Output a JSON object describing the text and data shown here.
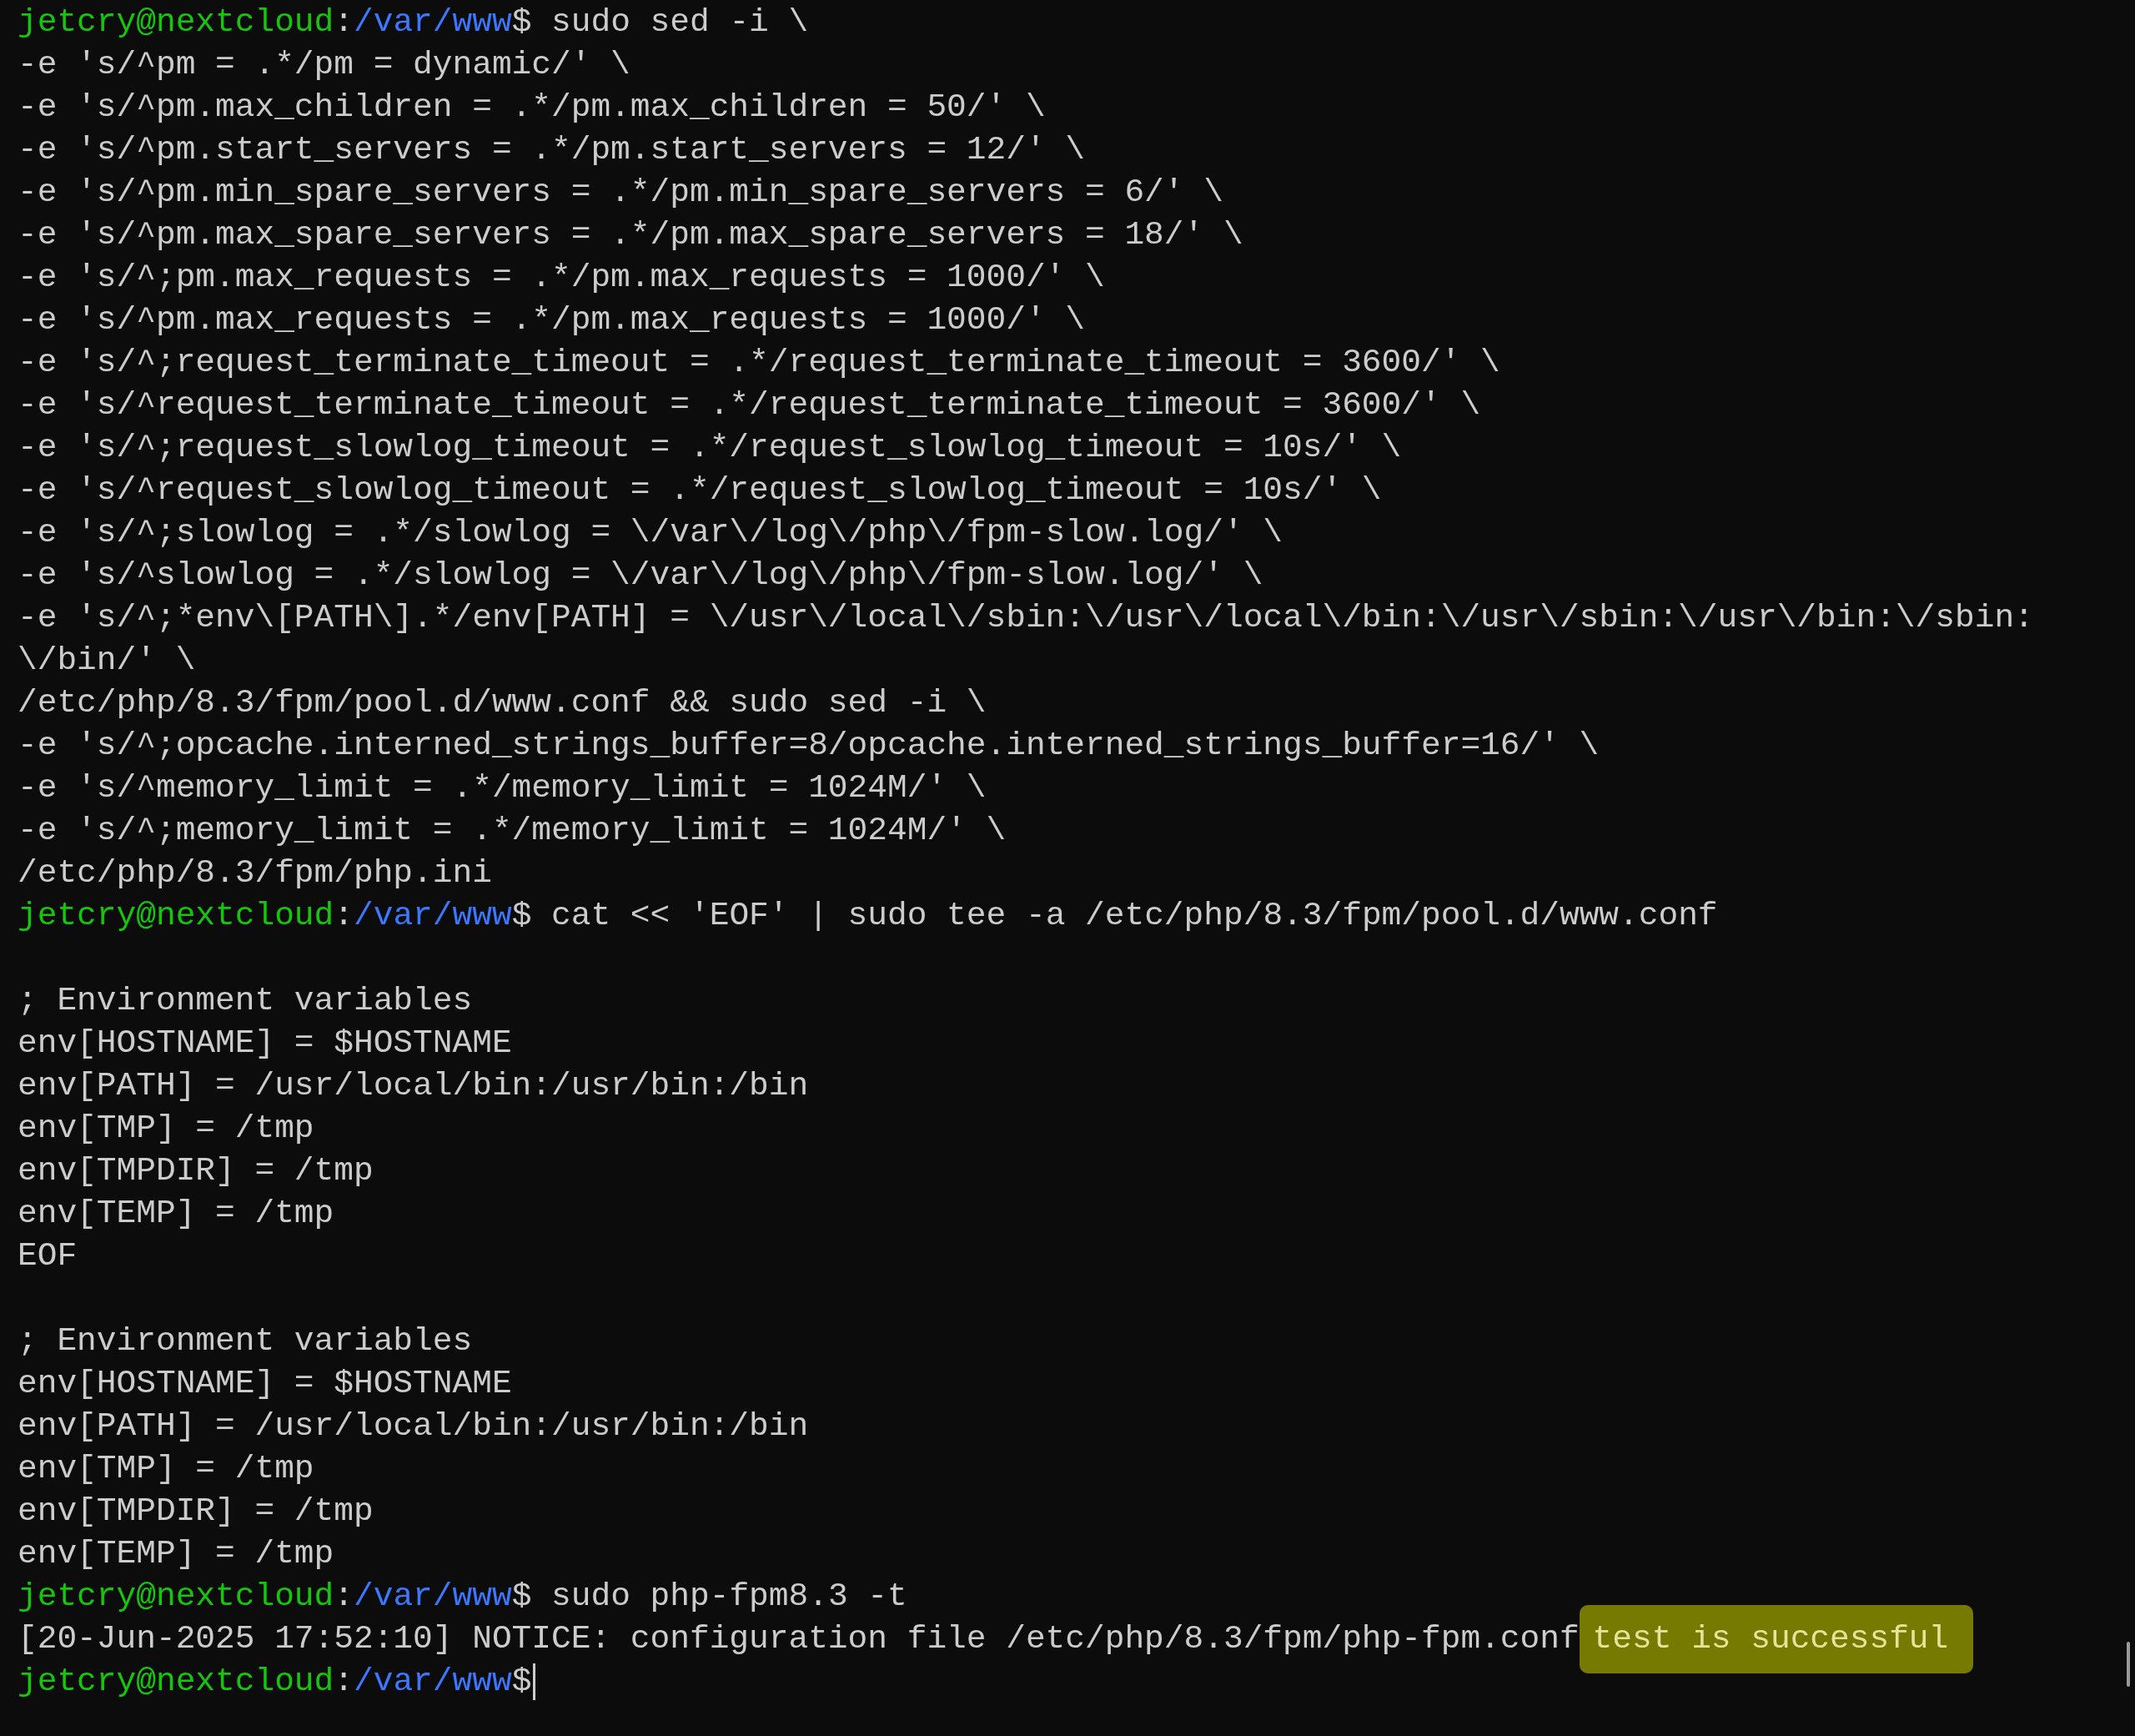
{
  "terminal": {
    "lines": [
      {
        "kind": "prompt",
        "user_host": "jetcry@nextcloud",
        "separator": ":",
        "path": "/var/www",
        "symbol": "$",
        "command": " sudo sed -i \\",
        "cursor": false
      },
      {
        "kind": "output",
        "text": "-e 's/^pm = .*/pm = dynamic/' \\"
      },
      {
        "kind": "output",
        "text": "-e 's/^pm.max_children = .*/pm.max_children = 50/' \\"
      },
      {
        "kind": "output",
        "text": "-e 's/^pm.start_servers = .*/pm.start_servers = 12/' \\"
      },
      {
        "kind": "output",
        "text": "-e 's/^pm.min_spare_servers = .*/pm.min_spare_servers = 6/' \\"
      },
      {
        "kind": "output",
        "text": "-e 's/^pm.max_spare_servers = .*/pm.max_spare_servers = 18/' \\"
      },
      {
        "kind": "output",
        "text": "-e 's/^;pm.max_requests = .*/pm.max_requests = 1000/' \\"
      },
      {
        "kind": "output",
        "text": "-e 's/^pm.max_requests = .*/pm.max_requests = 1000/' \\"
      },
      {
        "kind": "output",
        "text": "-e 's/^;request_terminate_timeout = .*/request_terminate_timeout = 3600/' \\"
      },
      {
        "kind": "output",
        "text": "-e 's/^request_terminate_timeout = .*/request_terminate_timeout = 3600/' \\"
      },
      {
        "kind": "output",
        "text": "-e 's/^;request_slowlog_timeout = .*/request_slowlog_timeout = 10s/' \\"
      },
      {
        "kind": "output",
        "text": "-e 's/^request_slowlog_timeout = .*/request_slowlog_timeout = 10s/' \\"
      },
      {
        "kind": "output",
        "text": "-e 's/^;slowlog = .*/slowlog = \\/var\\/log\\/php\\/fpm-slow.log/' \\"
      },
      {
        "kind": "output",
        "text": "-e 's/^slowlog = .*/slowlog = \\/var\\/log\\/php\\/fpm-slow.log/' \\"
      },
      {
        "kind": "output",
        "text": "-e 's/^;*env\\[PATH\\].*/env[PATH] = \\/usr\\/local\\/sbin:\\/usr\\/local\\/bin:\\/usr\\/sbin:\\/usr\\/bin:\\/sbin:"
      },
      {
        "kind": "output",
        "text": "\\/bin/' \\"
      },
      {
        "kind": "output",
        "text": "/etc/php/8.3/fpm/pool.d/www.conf && sudo sed -i \\"
      },
      {
        "kind": "output",
        "text": "-e 's/^;opcache.interned_strings_buffer=8/opcache.interned_strings_buffer=16/' \\"
      },
      {
        "kind": "output",
        "text": "-e 's/^memory_limit = .*/memory_limit = 1024M/' \\"
      },
      {
        "kind": "output",
        "text": "-e 's/^;memory_limit = .*/memory_limit = 1024M/' \\"
      },
      {
        "kind": "output",
        "text": "/etc/php/8.3/fpm/php.ini"
      },
      {
        "kind": "prompt",
        "user_host": "jetcry@nextcloud",
        "separator": ":",
        "path": "/var/www",
        "symbol": "$",
        "command": " cat << 'EOF' | sudo tee -a /etc/php/8.3/fpm/pool.d/www.conf",
        "cursor": false
      },
      {
        "kind": "blank"
      },
      {
        "kind": "output",
        "text": "; Environment variables"
      },
      {
        "kind": "output",
        "text": "env[HOSTNAME] = $HOSTNAME"
      },
      {
        "kind": "output",
        "text": "env[PATH] = /usr/local/bin:/usr/bin:/bin"
      },
      {
        "kind": "output",
        "text": "env[TMP] = /tmp"
      },
      {
        "kind": "output",
        "text": "env[TMPDIR] = /tmp"
      },
      {
        "kind": "output",
        "text": "env[TEMP] = /tmp"
      },
      {
        "kind": "output",
        "text": "EOF"
      },
      {
        "kind": "blank"
      },
      {
        "kind": "output",
        "text": "; Environment variables"
      },
      {
        "kind": "output",
        "text": "env[HOSTNAME] = $HOSTNAME"
      },
      {
        "kind": "output",
        "text": "env[PATH] = /usr/local/bin:/usr/bin:/bin"
      },
      {
        "kind": "output",
        "text": "env[TMP] = /tmp"
      },
      {
        "kind": "output",
        "text": "env[TMPDIR] = /tmp"
      },
      {
        "kind": "output",
        "text": "env[TEMP] = /tmp"
      },
      {
        "kind": "prompt",
        "user_host": "jetcry@nextcloud",
        "separator": ":",
        "path": "/var/www",
        "symbol": "$",
        "command": " sudo php-fpm8.3 -t",
        "cursor": false
      },
      {
        "kind": "notice",
        "text": "[20-Jun-2025 17:52:10] NOTICE: configuration file /etc/php/8.3/fpm/php-fpm.conf",
        "highlight": "test is successful"
      },
      {
        "kind": "prompt",
        "user_host": "jetcry@nextcloud",
        "separator": ":",
        "path": "/var/www",
        "symbol": "$",
        "cursor": true
      }
    ]
  }
}
